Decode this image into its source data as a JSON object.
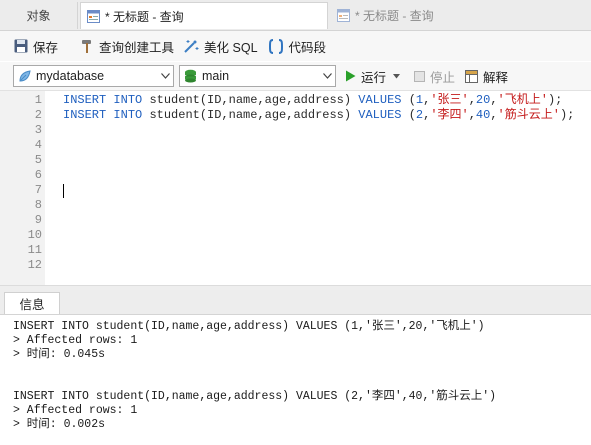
{
  "tabs": {
    "objects": "对象",
    "query_active": "* 无标题 - 查询",
    "query_inactive": "* 无标题 - 查询"
  },
  "toolbar": {
    "save": "保存",
    "query_builder": "查询创建工具",
    "beautify_sql": "美化 SQL",
    "code_snippet": "代码段"
  },
  "selectors": {
    "database": "mydatabase",
    "schema": "main"
  },
  "actions": {
    "run": "运行",
    "stop": "停止",
    "explain": "解释"
  },
  "editor": {
    "line_numbers": [
      "1",
      "2",
      "3",
      "4",
      "5",
      "6",
      "7",
      "8",
      "9",
      "10",
      "11",
      "12"
    ],
    "lines": [
      {
        "kw1": "INSERT",
        "kw2": "INTO",
        "head": "student(ID,name,age,address)",
        "kw3": "VALUES",
        "open": "(",
        "n1": "1",
        "c1": ",",
        "s1": "'张三'",
        "c2": ",",
        "n2": "20",
        "c3": ",",
        "s2": "'飞机上'",
        "close": ");"
      },
      {
        "kw1": "INSERT",
        "kw2": "INTO",
        "head": "student(ID,name,age,address)",
        "kw3": "VALUES",
        "open": "(",
        "n1": "2",
        "c1": ",",
        "s1": "'李四'",
        "c2": ",",
        "n2": "40",
        "c3": ",",
        "s2": "'筋斗云上'",
        "close": ");"
      }
    ]
  },
  "messages": {
    "tab": "信息",
    "lines": [
      "INSERT INTO student(ID,name,age,address) VALUES (1,'张三',20,'飞机上')",
      "> Affected rows: 1",
      "> 时间: 0.045s",
      "",
      "",
      "INSERT INTO student(ID,name,age,address) VALUES (2,'李四',40,'筋斗云上')",
      "> Affected rows: 1",
      "> 时间: 0.002s"
    ]
  },
  "icons": {
    "query_tab": "query-tab-icon",
    "save": "save-icon",
    "query_builder": "hammer-icon",
    "beautify": "wand-icon",
    "snippet": "braces-icon",
    "database": "database-leaf-icon",
    "schema": "schema-stack-icon",
    "run": "play-icon",
    "stop": "stop-icon",
    "explain": "explain-icon"
  },
  "colors": {
    "keyword": "#1f5fbf",
    "string": "#c41a1a",
    "run_green": "#2aa02a",
    "schema_green": "#3a9a3a"
  }
}
